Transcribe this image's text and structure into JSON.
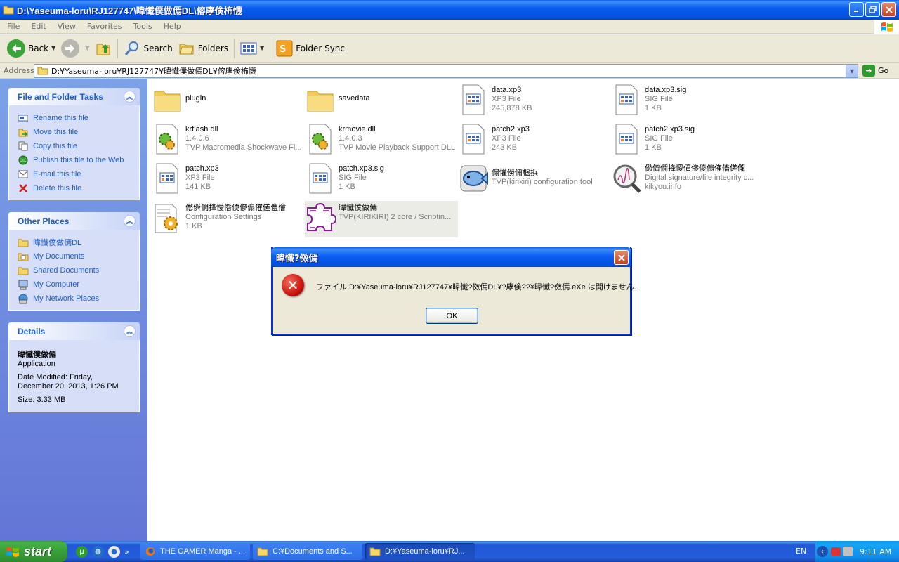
{
  "window": {
    "title": "D:\\Yaseuma-loru\\RJ127747\\暐懴僕做傿DL\\傛庨倹柨懱"
  },
  "menu": [
    "File",
    "Edit",
    "View",
    "Favorites",
    "Tools",
    "Help"
  ],
  "toolbar": {
    "back": "Back",
    "search": "Search",
    "folders": "Folders",
    "folder_sync": "Folder Sync"
  },
  "address": {
    "label": "Address",
    "value": "D:¥Yaseuma-loru¥RJ127747¥暐懴僕做傿DL¥傛庨倹柨懱",
    "go": "Go"
  },
  "left_pane": {
    "tasks": {
      "title": "File and Folder Tasks",
      "items": [
        {
          "label": "Rename this file",
          "icon": "rename-icon"
        },
        {
          "label": "Move this file",
          "icon": "move-icon"
        },
        {
          "label": "Copy this file",
          "icon": "copy-icon"
        },
        {
          "label": "Publish this file to the Web",
          "icon": "web-icon"
        },
        {
          "label": "E-mail this file",
          "icon": "email-icon"
        },
        {
          "label": "Delete this file",
          "icon": "delete-icon"
        }
      ]
    },
    "places": {
      "title": "Other Places",
      "items": [
        {
          "label": "暐懴僕做傿DL",
          "icon": "folder-icon"
        },
        {
          "label": "My Documents",
          "icon": "my-documents-icon"
        },
        {
          "label": "Shared Documents",
          "icon": "folder-icon"
        },
        {
          "label": "My Computer",
          "icon": "computer-icon"
        },
        {
          "label": "My Network Places",
          "icon": "network-icon"
        }
      ]
    },
    "details": {
      "title": "Details",
      "name": "暐懴僕做傿",
      "type": "Application",
      "modified_1": "Date Modified: Friday,",
      "modified_2": "December 20, 2013, 1:26 PM",
      "size": "Size: 3.33 MB"
    }
  },
  "files": [
    {
      "name": "plugin",
      "line2": "",
      "line3": "",
      "kind": "folder"
    },
    {
      "name": "savedata",
      "line2": "",
      "line3": "",
      "kind": "folder"
    },
    {
      "name": "data.xp3",
      "line2": "XP3 File",
      "line3": "245,878 KB",
      "kind": "doc"
    },
    {
      "name": "data.xp3.sig",
      "line2": "SIG File",
      "line3": "1 KB",
      "kind": "doc"
    },
    {
      "name": "krflash.dll",
      "line2": "1.4.0.6",
      "line3": "TVP Macromedia Shockwave Fl...",
      "kind": "dll"
    },
    {
      "name": "krmovie.dll",
      "line2": "1.4.0.3",
      "line3": "TVP Movie Playback Support DLL",
      "kind": "dll"
    },
    {
      "name": "patch2.xp3",
      "line2": "XP3 File",
      "line3": "243 KB",
      "kind": "doc"
    },
    {
      "name": "patch2.xp3.sig",
      "line2": "SIG File",
      "line3": "1 KB",
      "kind": "doc"
    },
    {
      "name": "patch.xp3",
      "line2": "XP3 File",
      "line3": "141 KB",
      "kind": "doc"
    },
    {
      "name": "patch.xp3.sig",
      "line2": "SIG File",
      "line3": "1 KB",
      "kind": "doc"
    },
    {
      "name": "傓懽僗儞椻捠",
      "line2": "TVP(kirikiri) configuration tool",
      "line3": "",
      "kind": "fish"
    },
    {
      "name": "僽儕僩捀懓僨傪倰傓傕傗傞儱",
      "line2": "Digital signature/file integrity c...",
      "line3": "kikyou.info",
      "kind": "magnifier"
    },
    {
      "name": "僽僢僩捀懓偺偄傪傓傕傞僼儈",
      "line2": "Configuration Settings",
      "line3": "1 KB",
      "kind": "config"
    },
    {
      "name": "暐懴僕做傿",
      "line2": "TVP(KIRIKIRI) 2 core / Scriptin...",
      "line3": "",
      "kind": "puzzle"
    }
  ],
  "dialog": {
    "title": "暐懴?傚傿",
    "message": "ファイル D:¥Yaseuma-loru¥RJ127747¥暐懴?傚傿DL¥?庨倹??¥暐懴?傚傿.eXe は開けません.",
    "ok": "OK"
  },
  "taskbar": {
    "start": "start",
    "buttons": [
      {
        "label": "THE GAMER Manga - ...",
        "icon": "firefox-icon"
      },
      {
        "label": "C:¥Documents and S...",
        "icon": "folder-icon"
      },
      {
        "label": "D:¥Yaseuma-loru¥RJ...",
        "icon": "folder-icon"
      }
    ],
    "lang": "EN",
    "clock": "9:11 AM"
  }
}
